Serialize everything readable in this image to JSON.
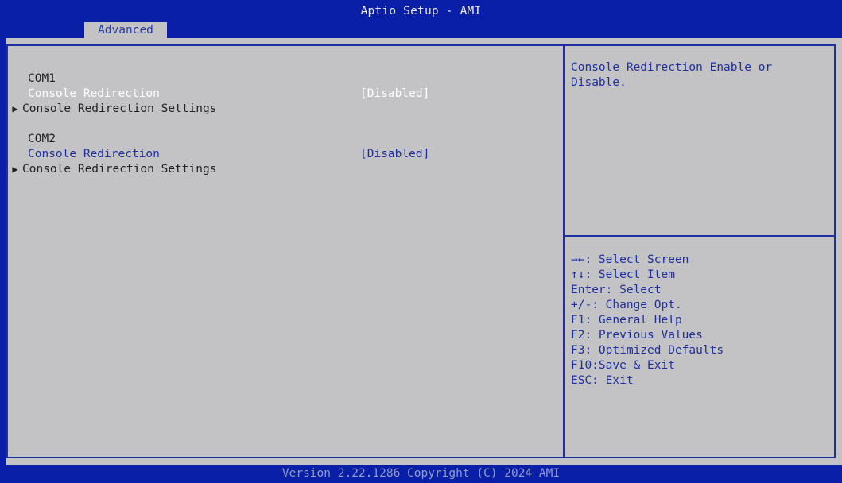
{
  "window": {
    "title": "Aptio Setup - AMI"
  },
  "tabs": [
    {
      "label": "Advanced",
      "active": true
    }
  ],
  "settings": {
    "com1_header": "COM1",
    "com1_redirection": {
      "label": "Console Redirection",
      "value": "[Disabled]"
    },
    "com1_settings": {
      "label": "Console Redirection Settings"
    },
    "com2_header": "COM2",
    "com2_redirection": {
      "label": "Console Redirection",
      "value": "[Disabled]"
    },
    "com2_settings": {
      "label": "Console Redirection Settings"
    }
  },
  "help": {
    "line1": "Console Redirection Enable or",
    "line2": "Disable."
  },
  "keys": [
    "→←: Select Screen",
    "↑↓: Select Item",
    "Enter: Select",
    "+/-: Change Opt.",
    "F1: General Help",
    "F2: Previous Values",
    "F3: Optimized Defaults",
    "F10:Save & Exit",
    "ESC: Exit"
  ],
  "footer": {
    "text": "Version 2.22.1286 Copyright (C) 2024 AMI"
  },
  "colors": {
    "bios_blue": "#0a1fa8",
    "panel_gray": "#c3c3c5",
    "text_blue": "#1f2fa0",
    "selected_text": "#ffffff"
  }
}
